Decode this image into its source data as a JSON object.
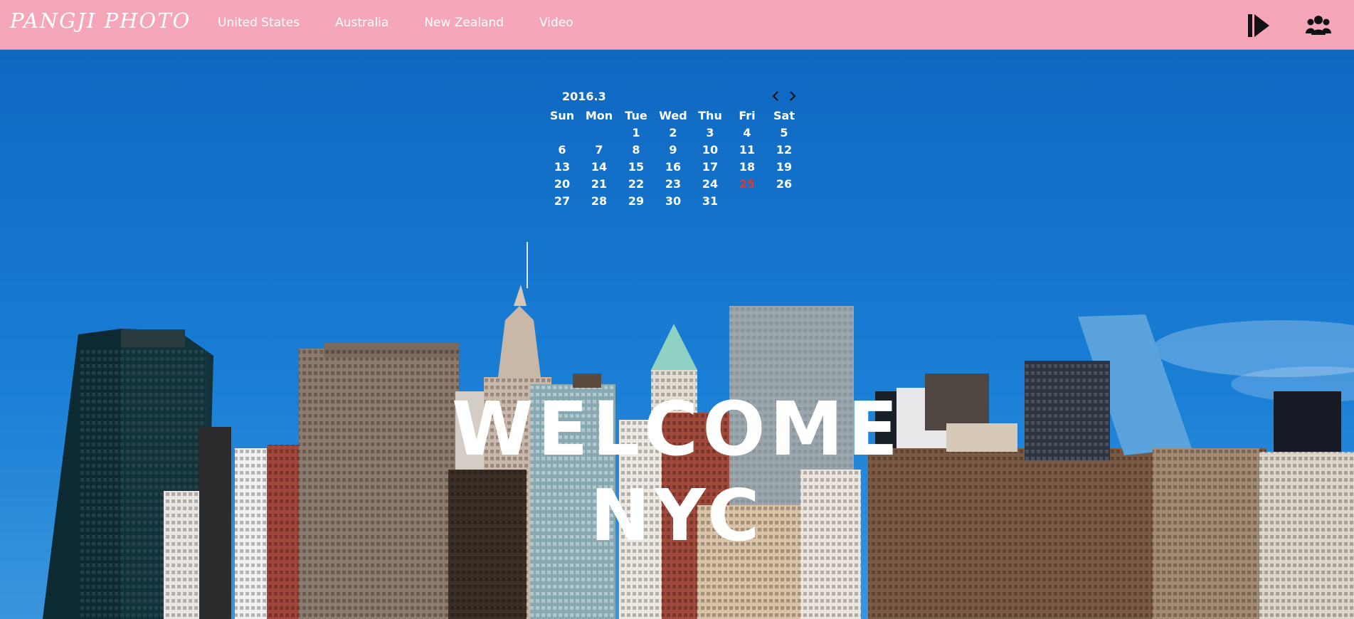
{
  "header": {
    "logo_text": "PANGJI PHOTO",
    "nav_items": [
      {
        "label": "United States"
      },
      {
        "label": "Australia"
      },
      {
        "label": "New Zealand"
      },
      {
        "label": "Video"
      }
    ],
    "icons": [
      "play-next-icon",
      "users-icon"
    ],
    "background_color": "#f5a7b9"
  },
  "calendar": {
    "title": "2016.3",
    "weekdays": [
      "Sun",
      "Mon",
      "Tue",
      "Wed",
      "Thu",
      "Fri",
      "Sat"
    ],
    "weeks": [
      [
        "",
        "",
        "1",
        "2",
        "3",
        "4",
        "5"
      ],
      [
        "6",
        "7",
        "8",
        "9",
        "10",
        "11",
        "12"
      ],
      [
        "13",
        "14",
        "15",
        "16",
        "17",
        "18",
        "19"
      ],
      [
        "20",
        "21",
        "22",
        "23",
        "24",
        "25",
        "26"
      ],
      [
        "27",
        "28",
        "29",
        "30",
        "31",
        "",
        ""
      ]
    ],
    "today": "25",
    "today_color": "#d93a3a"
  },
  "hero": {
    "line1": "WELCOME",
    "line2": "NYC",
    "sky_color": "#1570c6"
  }
}
